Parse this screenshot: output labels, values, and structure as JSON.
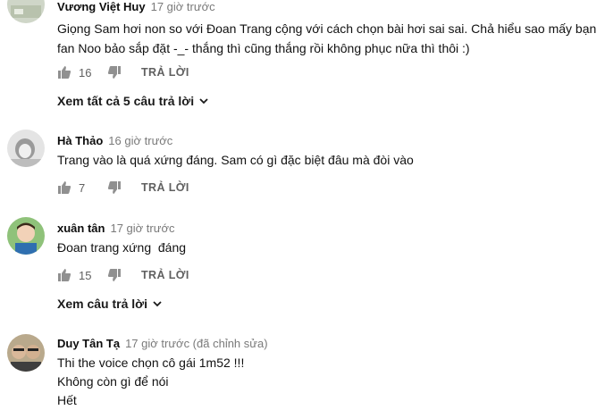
{
  "comments": [
    {
      "author": "Vương Việt Huy",
      "time": "17 giờ trước",
      "lines": [
        "Giọng Sam hơi non so với Đoan Trang cộng với cách chọn bài hơi sai sai. Chả hiểu sao mấy bạn",
        "fan Noo bảo sắp đặt -_- thắng thì cũng thắng rồi không phục nữa thì thôi :)"
      ],
      "likes": "16",
      "reply_label": "TRẢ LỜI",
      "view_replies": "Xem tất cả 5 câu trả lời"
    },
    {
      "author": "Hà Thảo",
      "time": "16 giờ trước",
      "lines": [
        "Trang vào là quá xứng đáng. Sam có gì đặc biệt đâu mà đòi vào"
      ],
      "likes": "7",
      "reply_label": "TRẢ LỜI"
    },
    {
      "author": "xuân tân",
      "time": "17 giờ trước",
      "lines": [
        "Đoan trang xứng  đáng"
      ],
      "likes": "15",
      "reply_label": "TRẢ LỜI",
      "view_replies": "Xem câu trả lời"
    },
    {
      "author": "Duy Tân Tạ",
      "time": "17 giờ trước (đã chỉnh sửa)",
      "lines": [
        "Thi the voice chọn cô gái 1m52 !!!",
        "Không còn gì để nói",
        "Hết"
      ]
    }
  ],
  "icons": {
    "like": "thumbs-up-icon",
    "dislike": "thumbs-down-icon",
    "chevron": "chevron-down-icon"
  },
  "colors": {
    "icon": "#909090",
    "meta_text": "#7a7a7a"
  }
}
